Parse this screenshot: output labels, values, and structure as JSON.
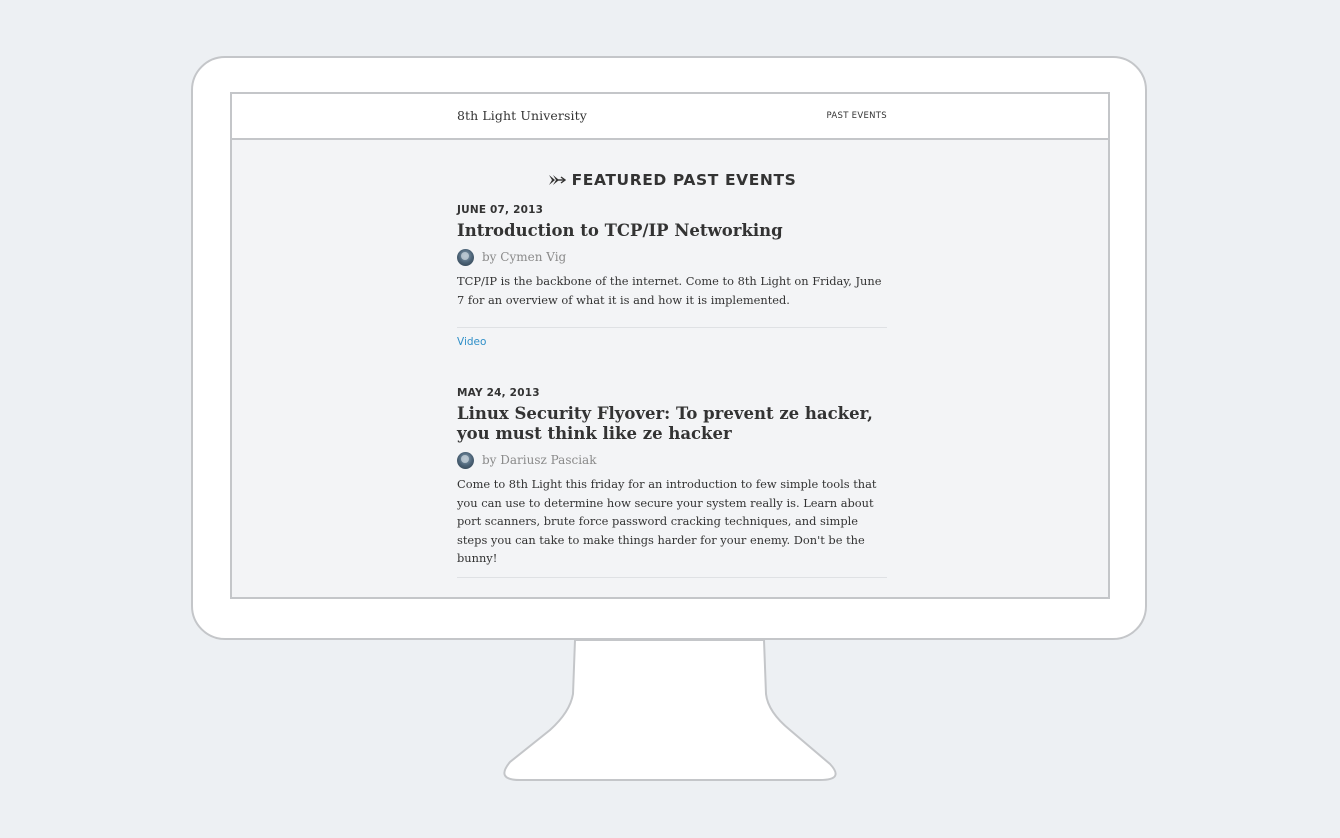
{
  "header": {
    "site_title": "8th Light University",
    "nav_past_events": "PAST EVENTS"
  },
  "main": {
    "heading": "FEATURED PAST EVENTS",
    "heading_icon": "arrow-icon",
    "events": [
      {
        "date": "JUNE 07, 2013",
        "title": "Introduction to TCP/IP Networking",
        "author": "by Cymen Vig",
        "description": "TCP/IP is the backbone of the internet. Come to 8th Light on Friday, June 7 for an overview of what it is and how it is implemented.",
        "video_label": "Video"
      },
      {
        "date": "MAY 24, 2013",
        "title": "Linux Security Flyover: To prevent ze hacker, you must think like ze hacker",
        "author": "by Dariusz Pasciak",
        "description": "Come to 8th Light this friday for an introduction to few simple tools that you can use to determine how secure your system really is. Learn about port scanners, brute force password cracking techniques, and simple steps you can take to make things harder for your enemy. Don't be the bunny!"
      }
    ]
  },
  "colors": {
    "background": "#edf0f3",
    "link": "#2f8fc8",
    "text": "#333333",
    "muted": "#8a8a8a"
  }
}
